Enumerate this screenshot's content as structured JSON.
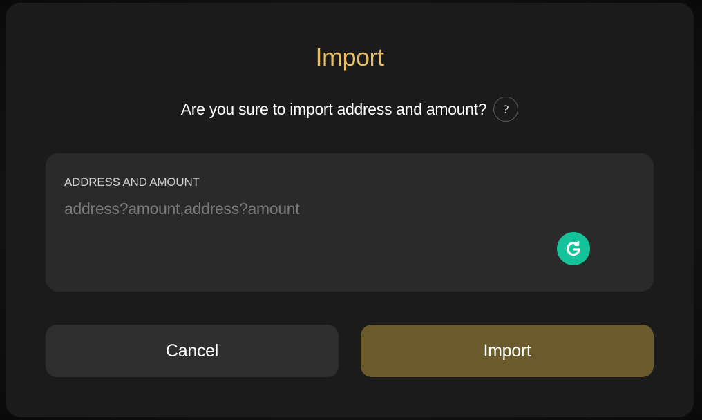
{
  "dialog": {
    "title": "Import",
    "subtitle": "Are you sure to import address and amount?",
    "help_glyph": "?"
  },
  "field": {
    "label": "ADDRESS AND AMOUNT",
    "value": "",
    "placeholder": "address?amount,address?amount"
  },
  "buttons": {
    "cancel_label": "Cancel",
    "import_label": "Import"
  },
  "icons": {
    "help": "question-icon",
    "grammarly": "grammarly-icon"
  },
  "colors": {
    "accent_title": "#e8bd68",
    "import_button": "#6a5a2c",
    "cancel_button": "#2e2e2e",
    "modal_bg": "#1b1b1b",
    "field_bg": "#2a2a2a",
    "grammarly": "#15c39a"
  }
}
